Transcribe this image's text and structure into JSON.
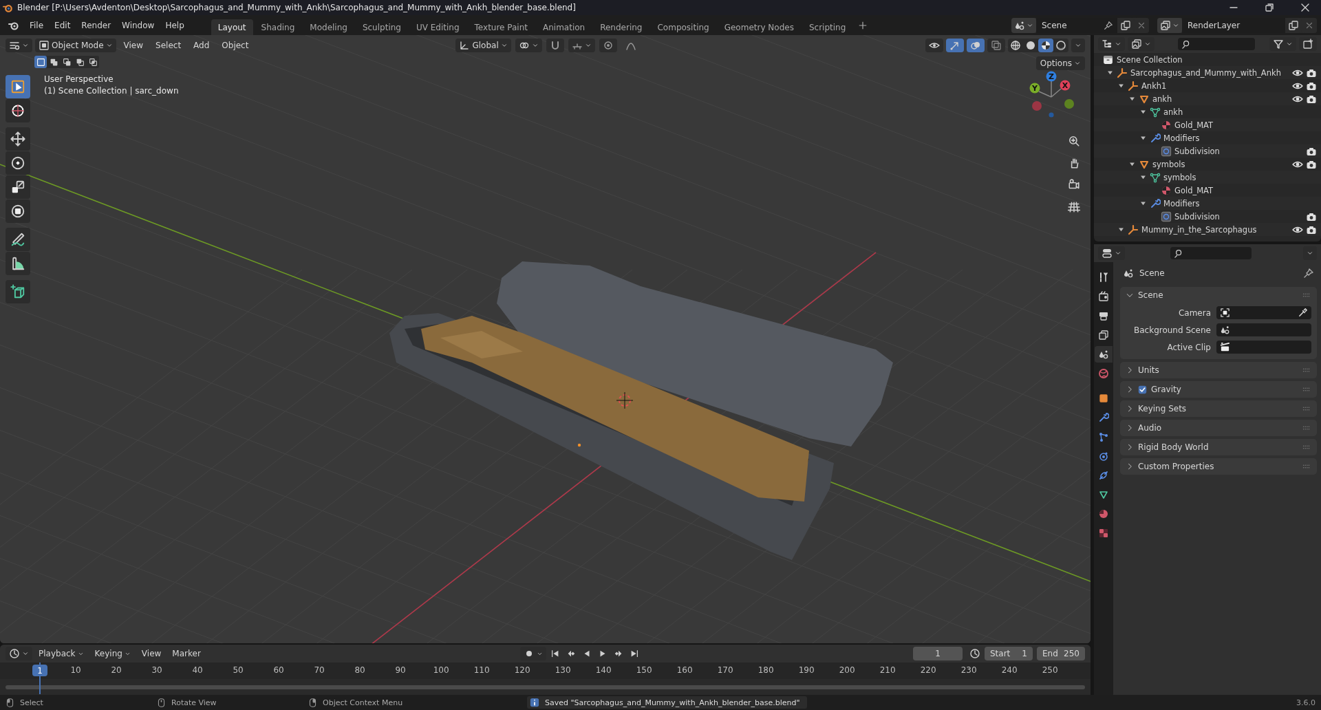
{
  "window": {
    "title": "Blender [P:\\Users\\Avdenton\\Desktop\\Sarcophagus_and_Mummy_with_Ankh\\Sarcophagus_and_Mummy_with_Ankh_blender_base.blend]"
  },
  "menu": [
    "File",
    "Edit",
    "Render",
    "Window",
    "Help"
  ],
  "workspaces": [
    {
      "label": "Layout",
      "selected": true
    },
    {
      "label": "Shading",
      "selected": false
    },
    {
      "label": "Modeling",
      "selected": false
    },
    {
      "label": "Sculpting",
      "selected": false
    },
    {
      "label": "UV Editing",
      "selected": false
    },
    {
      "label": "Texture Paint",
      "selected": false
    },
    {
      "label": "Animation",
      "selected": false
    },
    {
      "label": "Rendering",
      "selected": false
    },
    {
      "label": "Compositing",
      "selected": false
    },
    {
      "label": "Geometry Nodes",
      "selected": false
    },
    {
      "label": "Scripting",
      "selected": false
    }
  ],
  "scene": {
    "value": "Scene"
  },
  "view_layer": {
    "value": "RenderLayer"
  },
  "viewport": {
    "mode": "Object Mode",
    "menus": [
      "View",
      "Select",
      "Add",
      "Object"
    ],
    "orientation": "Global",
    "options": "Options",
    "info": [
      "User Perspective",
      "(1) Scene Collection | sarc_down"
    ],
    "select_modes": [
      {
        "kind": "new",
        "selected": true
      },
      {
        "kind": "extend",
        "selected": false
      },
      {
        "kind": "subtract",
        "selected": false
      },
      {
        "kind": "invert",
        "selected": false
      },
      {
        "kind": "intersect",
        "selected": false
      }
    ],
    "toggles": [
      {
        "kind": "visibility",
        "on": false
      },
      {
        "kind": "gizmo",
        "on": true
      },
      {
        "kind": "overlay",
        "on": true
      },
      {
        "kind": "xray",
        "on": false
      }
    ],
    "shading": [
      {
        "kind": "wireframe",
        "selected": false
      },
      {
        "kind": "solid",
        "selected": false
      },
      {
        "kind": "material",
        "selected": true
      },
      {
        "kind": "rendered",
        "selected": false
      }
    ],
    "tools": [
      {
        "kind": "select",
        "selected": true
      },
      {
        "kind": "cursor",
        "selected": false
      },
      {
        "kind": "move",
        "selected": false
      },
      {
        "kind": "rotate",
        "selected": false
      },
      {
        "kind": "scale",
        "selected": false
      },
      {
        "kind": "transform",
        "selected": false
      },
      {
        "kind": "annotate",
        "selected": false
      },
      {
        "kind": "measure",
        "selected": false
      },
      {
        "kind": "add_cube",
        "selected": false
      }
    ],
    "gizmo_axes": [
      {
        "label": "Z",
        "color": "#2f7fe0"
      },
      {
        "label": "X",
        "color": "#e0415a"
      },
      {
        "label": "Y",
        "color": "#7aad28"
      }
    ]
  },
  "outliner": {
    "root": "Scene Collection",
    "items": [
      {
        "label": "Sarcophagus_and_Mummy_with_Ankh",
        "kind": "empty",
        "expanded": true,
        "visible": true,
        "renderable": true,
        "children": [
          {
            "label": "Ankh1",
            "kind": "empty",
            "expanded": true,
            "visible": true,
            "renderable": true,
            "children": [
              {
                "label": "ankh",
                "kind": "object",
                "expanded": true,
                "visible": true,
                "renderable": true,
                "children": [
                  {
                    "label": "ankh",
                    "kind": "mesh",
                    "expanded": true,
                    "children": [
                      {
                        "label": "Gold_MAT",
                        "kind": "material"
                      }
                    ]
                  },
                  {
                    "label": "Modifiers",
                    "kind": "modifiers",
                    "expanded": true,
                    "children": [
                      {
                        "label": "Subdivision",
                        "kind": "modifier",
                        "renderable": true
                      }
                    ]
                  }
                ]
              },
              {
                "label": "symbols",
                "kind": "object",
                "expanded": true,
                "visible": true,
                "renderable": true,
                "children": [
                  {
                    "label": "symbols",
                    "kind": "mesh",
                    "expanded": true,
                    "children": [
                      {
                        "label": "Gold_MAT",
                        "kind": "material"
                      }
                    ]
                  },
                  {
                    "label": "Modifiers",
                    "kind": "modifiers",
                    "expanded": true,
                    "children": [
                      {
                        "label": "Subdivision",
                        "kind": "modifier",
                        "renderable": true
                      }
                    ]
                  }
                ]
              }
            ]
          },
          {
            "label": "Mummy_in_the_Sarcophagus",
            "kind": "empty",
            "expanded": true,
            "visible": true,
            "renderable": true
          }
        ]
      }
    ]
  },
  "properties": {
    "title": "Scene",
    "tabs": [
      {
        "kind": "tool",
        "selected": false
      },
      {
        "kind": "render",
        "selected": false
      },
      {
        "kind": "output",
        "selected": false
      },
      {
        "kind": "view_layer",
        "selected": false
      },
      {
        "kind": "scene",
        "selected": true
      },
      {
        "kind": "world",
        "selected": false
      },
      {
        "kind": "object",
        "selected": false
      },
      {
        "kind": "modifiers",
        "selected": false
      },
      {
        "kind": "particles",
        "selected": false
      },
      {
        "kind": "physics",
        "selected": false
      },
      {
        "kind": "constraints",
        "selected": false
      },
      {
        "kind": "data",
        "selected": false
      },
      {
        "kind": "material",
        "selected": false
      },
      {
        "kind": "texture",
        "selected": false
      }
    ],
    "panels": [
      {
        "label": "Scene",
        "expanded": true,
        "fields": [
          {
            "label": "Camera",
            "kind": "camera"
          },
          {
            "label": "Background Scene",
            "kind": "scene"
          },
          {
            "label": "Active Clip",
            "kind": "clip"
          }
        ]
      },
      {
        "label": "Units",
        "expanded": false
      },
      {
        "label": "Gravity",
        "expanded": false,
        "checked": true
      },
      {
        "label": "Keying Sets",
        "expanded": false
      },
      {
        "label": "Audio",
        "expanded": false
      },
      {
        "label": "Rigid Body World",
        "expanded": false
      },
      {
        "label": "Custom Properties",
        "expanded": false
      }
    ]
  },
  "timeline": {
    "menus": [
      "Playback",
      "Keying",
      "View",
      "Marker"
    ],
    "current_frame": "1",
    "start_label": "Start",
    "start": "1",
    "end_label": "End",
    "end": "250",
    "playhead": "1",
    "ticks": [
      "10",
      "20",
      "30",
      "40",
      "50",
      "60",
      "70",
      "80",
      "90",
      "100",
      "110",
      "120",
      "130",
      "140",
      "150",
      "160",
      "170",
      "180",
      "190",
      "200",
      "210",
      "220",
      "230",
      "240",
      "250"
    ]
  },
  "status": {
    "hints": [
      {
        "label": "Select",
        "kind": "left"
      },
      {
        "label": "Rotate View",
        "kind": "middle"
      },
      {
        "label": "Object Context Menu",
        "kind": "right"
      }
    ],
    "message": "Saved \"Sarcophagus_and_Mummy_with_Ankh_blender_base.blend\"",
    "version": "3.6.0"
  }
}
